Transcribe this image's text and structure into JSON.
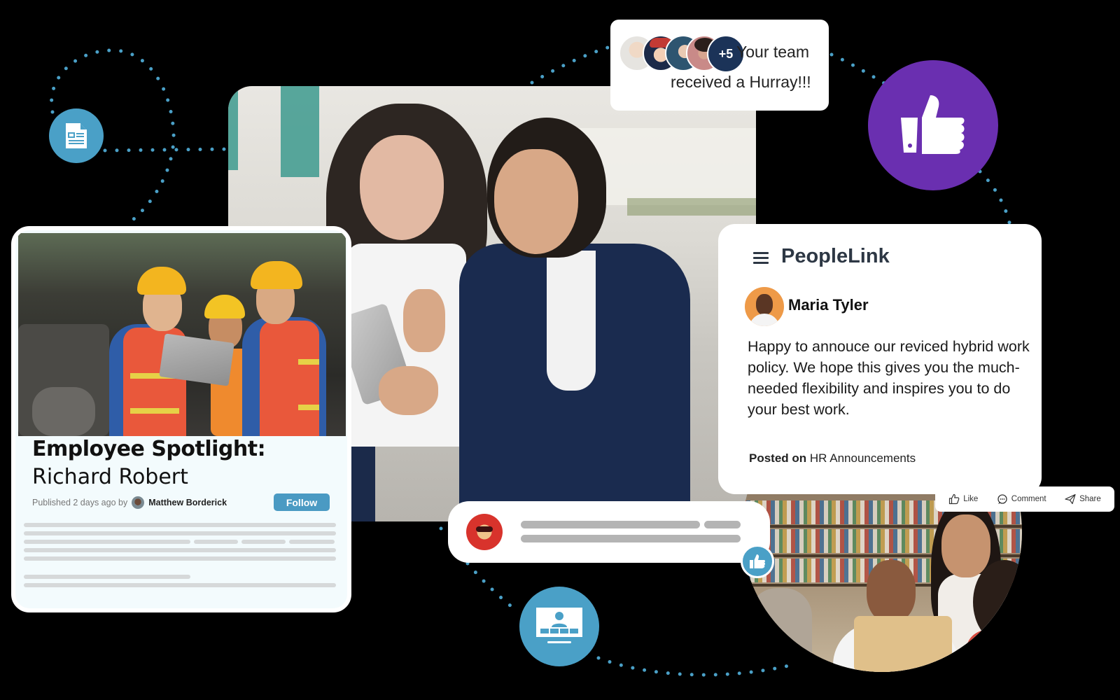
{
  "hurray_toast": {
    "extra_count": "+5",
    "line1": "Your team",
    "line2": "received a Hurray!!!"
  },
  "spotlight": {
    "title": "Employee Spotlight:",
    "name": "Richard Robert",
    "published": "Published 2 days ago by",
    "author": "Matthew Borderick",
    "follow_label": "Follow"
  },
  "post": {
    "brand": "PeopleLink",
    "author": "Maria Tyler",
    "body": "Happy to annouce our reviced hybrid work policy. We hope this gives you the much-needed flexibility and inspires you to do your best work.",
    "posted_on_label": "Posted on",
    "posted_on_value": "HR Announcements"
  },
  "actions": {
    "like": "Like",
    "comment": "Comment",
    "share": "Share"
  },
  "icons": {
    "doc_badge": "document-icon",
    "like_badge": "thumbs-up-icon",
    "video_badge": "video-call-icon",
    "menu": "hamburger-menu-icon"
  },
  "colors": {
    "accent_blue": "#4aa0c7",
    "purple": "#6a2fb0",
    "navy": "#1b3358",
    "brand_text": "#2d3744",
    "background": "#000000"
  }
}
